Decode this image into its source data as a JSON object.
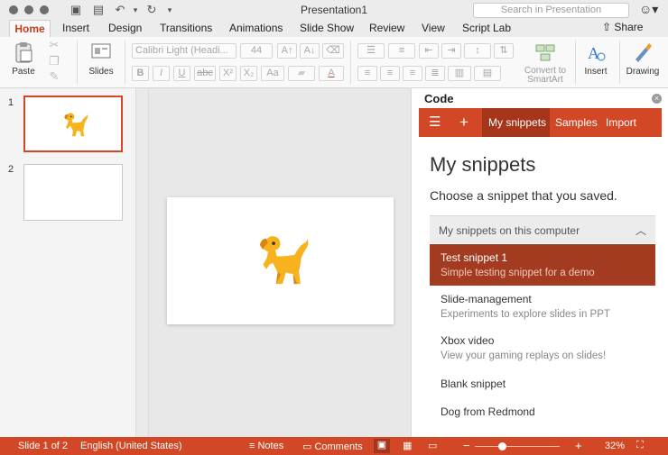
{
  "window": {
    "title": "Presentation1",
    "search_placeholder": "Search in Presentation",
    "smiley_icon": "smiley-icon"
  },
  "tabs": [
    {
      "label": "Home"
    },
    {
      "label": "Insert"
    },
    {
      "label": "Design"
    },
    {
      "label": "Transitions"
    },
    {
      "label": "Animations"
    },
    {
      "label": "Slide Show"
    },
    {
      "label": "Review"
    },
    {
      "label": "View"
    },
    {
      "label": "Script Lab"
    }
  ],
  "share_label": "Share",
  "ribbon": {
    "paste_label": "Paste",
    "slides_label": "Slides",
    "font_name": "Calibri Light (Headi...",
    "font_size": "44",
    "convert_label_1": "Convert to",
    "convert_label_2": "SmartArt",
    "insert_label": "Insert",
    "drawing_label": "Drawing",
    "bold": "B",
    "italic": "I",
    "underline": "U",
    "strike": "abc",
    "superscript": "X²",
    "subscript": "X₂",
    "grow": "A↑",
    "shrink": "A↓",
    "font_color": "A"
  },
  "thumbnails": [
    {
      "number": "1"
    },
    {
      "number": "2"
    }
  ],
  "pane": {
    "title": "Code",
    "nav": {
      "menu_icon": "hamburger-icon",
      "add_icon": "plus-icon",
      "my_snippets": "My snippets",
      "samples": "Samples",
      "import": "Import"
    },
    "heading": "My snippets",
    "subheading": "Choose a snippet that you saved.",
    "group_label": "My snippets on this computer",
    "snippets": [
      {
        "name": "Test snippet 1",
        "description": "Simple testing snippet for a demo"
      },
      {
        "name": "Slide-management",
        "description": "Experiments to explore slides in PPT"
      },
      {
        "name": "Xbox video",
        "description": "View your gaming replays on slides!"
      },
      {
        "name": "Blank snippet",
        "description": ""
      },
      {
        "name": "Dog from Redmond",
        "description": ""
      }
    ]
  },
  "status": {
    "slide_info": "Slide 1 of 2",
    "language": "English (United States)",
    "notes": "Notes",
    "comments": "Comments",
    "zoom_minus": "−",
    "zoom_plus": "+",
    "zoom": "32%",
    "zoom_level": 0.32
  },
  "colors": {
    "accent": "#d24726",
    "accent_dark": "#a5361b",
    "dog_body": "#f7b21e",
    "dog_dark": "#d78712"
  }
}
